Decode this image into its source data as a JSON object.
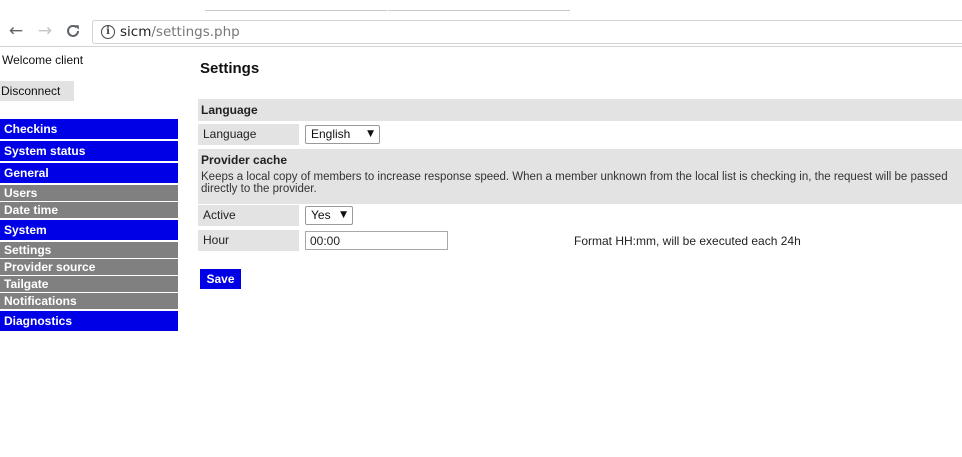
{
  "browser": {
    "back_icon": "←",
    "forward_icon": "→",
    "reload_icon": "C",
    "info_icon": "i",
    "url_host": "sicm",
    "url_path": "/settings.php"
  },
  "sidebar": {
    "welcome_text": "Welcome client",
    "disconnect_label": "Disconnect",
    "menu": [
      {
        "label": "Checkins",
        "type": "group"
      },
      {
        "label": "System status",
        "type": "group"
      },
      {
        "label": "General",
        "type": "group"
      },
      {
        "label": "Users",
        "type": "sub"
      },
      {
        "label": "Date time",
        "type": "sub"
      },
      {
        "label": "System",
        "type": "group"
      },
      {
        "label": "Settings",
        "type": "sub"
      },
      {
        "label": "Provider source",
        "type": "sub"
      },
      {
        "label": "Tailgate",
        "type": "sub"
      },
      {
        "label": "Notifications",
        "type": "sub"
      },
      {
        "label": "Diagnostics",
        "type": "group"
      }
    ]
  },
  "main": {
    "title": "Settings",
    "language_section": {
      "heading": "Language",
      "field_label": "Language",
      "selected": "English"
    },
    "provider_cache": {
      "heading": "Provider cache",
      "description": "Keeps a local copy of members to increase response speed. When a member unknown from the local list is checking in, the request will be passed directly to the provider.",
      "active_label": "Active",
      "active_selected": "Yes",
      "hour_label": "Hour",
      "hour_value": "00:00",
      "hour_hint": "Format HH:mm, will be executed each 24h"
    },
    "save_label": "Save"
  },
  "colors": {
    "menu_group": "#0000e6",
    "menu_sub": "#808080",
    "section_bg": "#e3e3e3"
  }
}
